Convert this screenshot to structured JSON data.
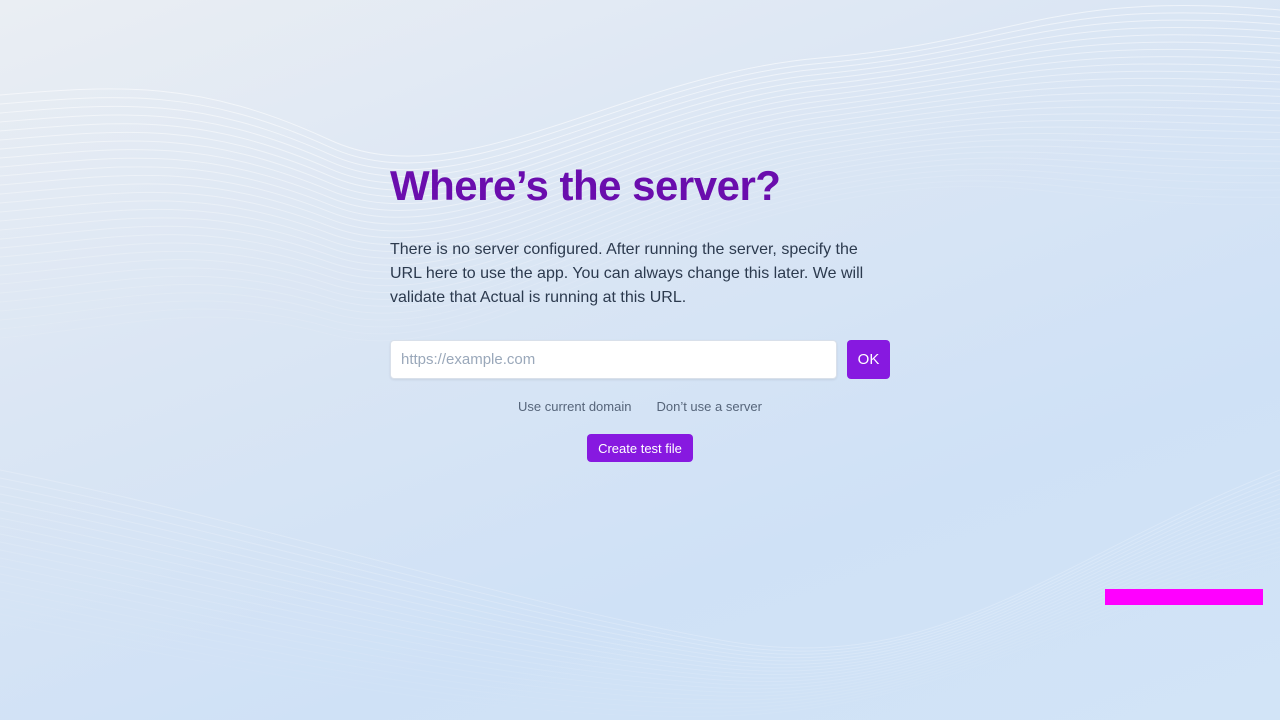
{
  "page": {
    "title": "Where’s the server?",
    "description": "There is no server configured. After running the server, specify the URL here to use the app. You can always change this later. We will validate that Actual is running at this URL."
  },
  "server_form": {
    "url_value": "",
    "url_placeholder": "https://example.com",
    "ok_label": "OK"
  },
  "options": {
    "use_current_domain_label": "Use current domain",
    "no_server_label": "Don’t use a server"
  },
  "test": {
    "create_test_file_label": "Create test file"
  },
  "colors": {
    "title": "#6a0dad",
    "primary_button": "#8719e0",
    "text": "#2c3a4e",
    "link": "#56657a",
    "debug_bar": "#ff00ff"
  }
}
